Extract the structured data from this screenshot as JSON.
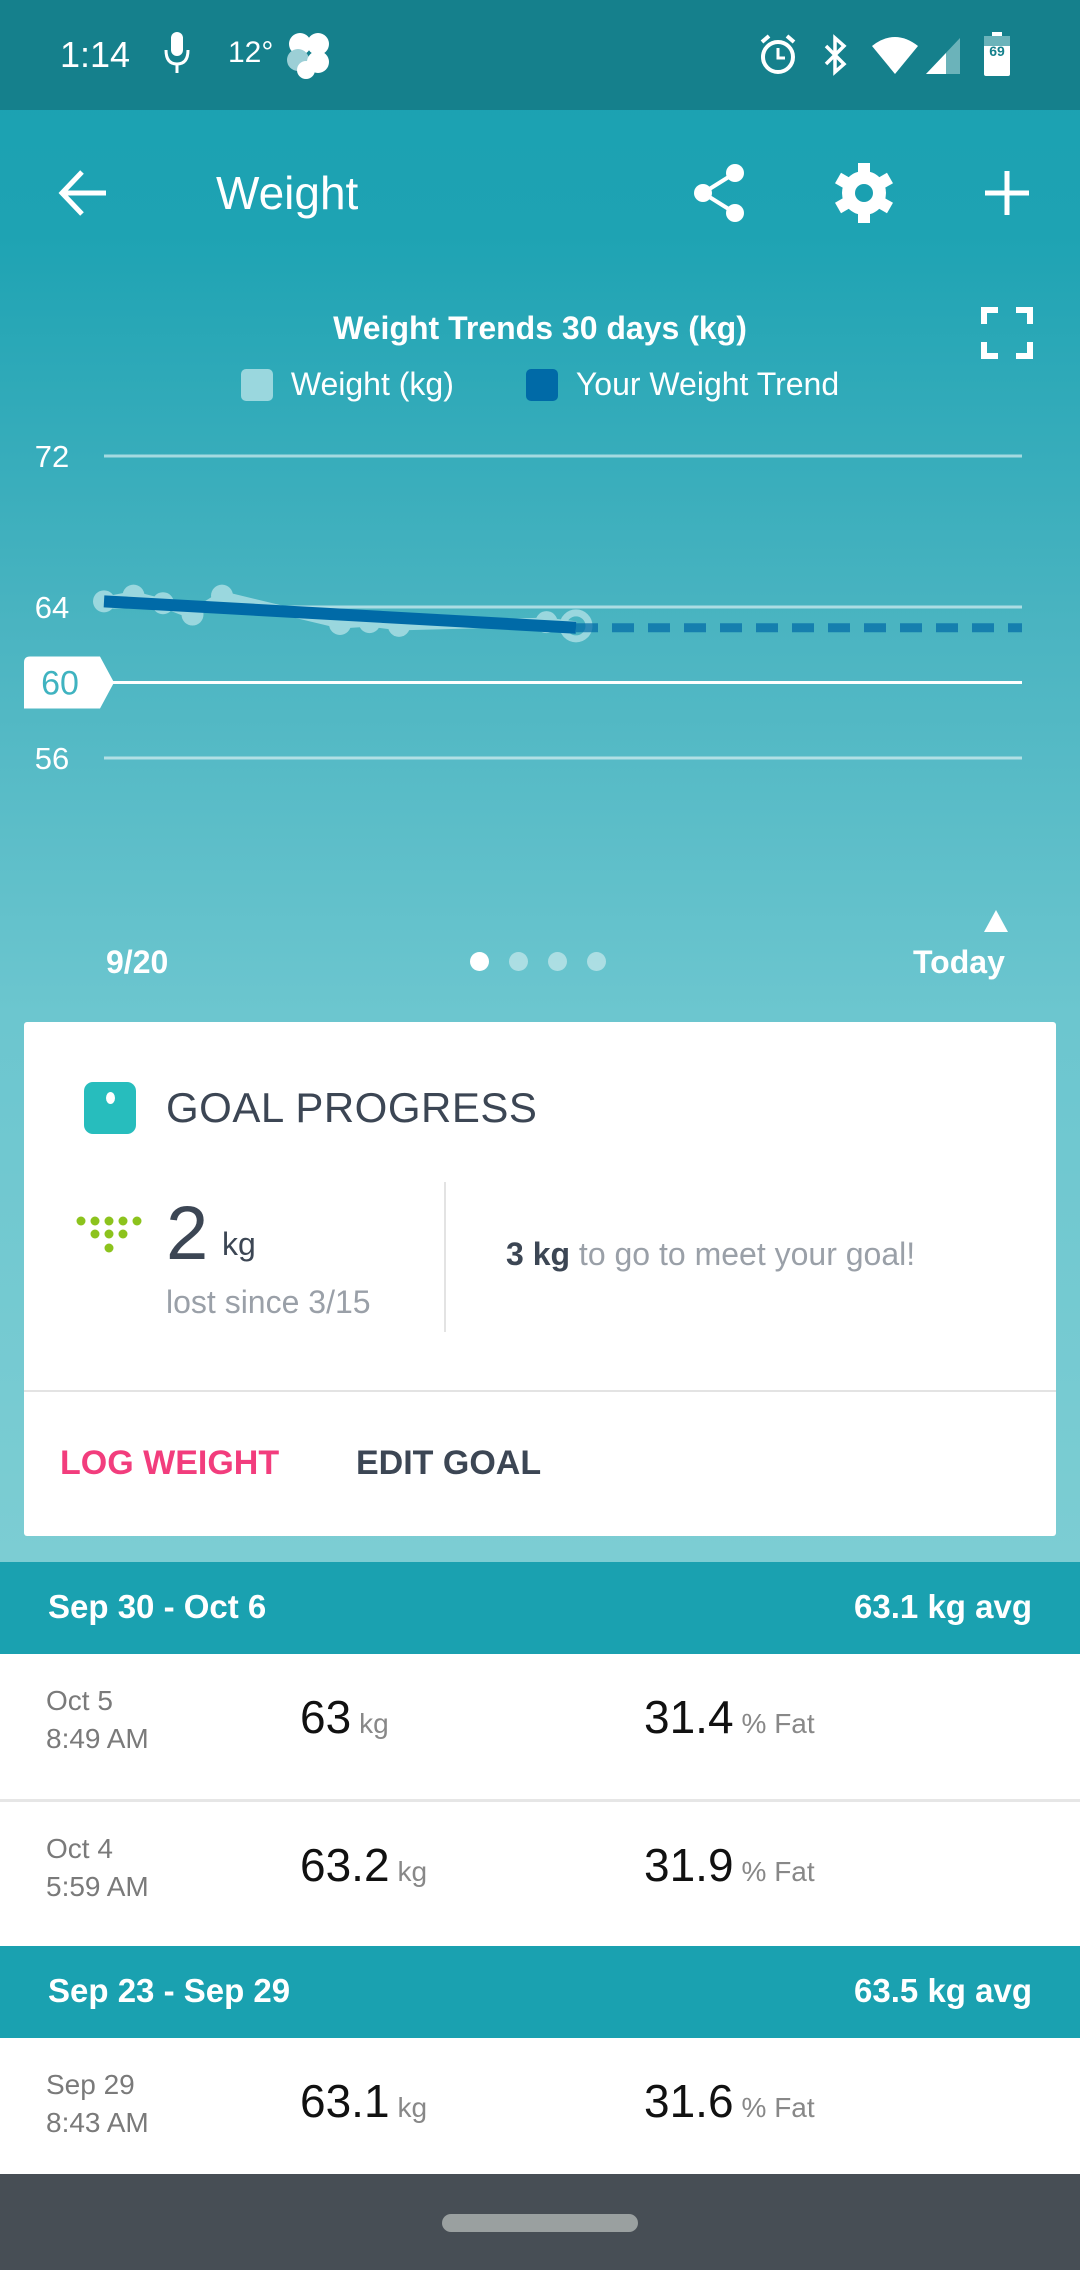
{
  "status_bar": {
    "time": "1:14",
    "temperature": "12°",
    "battery": "69",
    "icons": [
      "mic-icon",
      "fan-icon",
      "alarm-icon",
      "bluetooth-icon",
      "wifi-icon",
      "cell-signal-icon",
      "battery-icon"
    ]
  },
  "app_bar": {
    "title": "Weight",
    "back_icon": "arrow-left-icon",
    "share_icon": "share-icon",
    "settings_icon": "gear-icon",
    "add_icon": "plus-icon"
  },
  "chart": {
    "title": "Weight Trends 30 days (kg)",
    "expand_icon": "fullscreen-icon",
    "legend": [
      {
        "label": "Weight (kg)",
        "color": "#9ad7de"
      },
      {
        "label": "Your Weight Trend",
        "color": "#006aa7"
      }
    ],
    "x_start_label": "9/20",
    "x_end_label": "Today",
    "goal_label": "60",
    "pager": {
      "count": 4,
      "active": 0
    }
  },
  "chart_data": {
    "type": "line",
    "title": "Weight Trends 30 days (kg)",
    "xlabel": "",
    "ylabel": "kg",
    "y_ticks": [
      72,
      64,
      56
    ],
    "ylim": [
      54,
      74
    ],
    "goal_line": 60,
    "x_range_days": [
      0,
      30
    ],
    "x_tick_labels": [
      "9/20",
      "Today"
    ],
    "series": [
      {
        "name": "Weight (kg)",
        "color": "#9ad7de",
        "points": [
          [
            0,
            64.3
          ],
          [
            1,
            64.6
          ],
          [
            2,
            64.2
          ],
          [
            3,
            63.6
          ],
          [
            4,
            64.6
          ],
          [
            8,
            63.1
          ],
          [
            9,
            63.2
          ],
          [
            10,
            63.0
          ],
          [
            15,
            63.2
          ],
          [
            16,
            63.0
          ]
        ]
      },
      {
        "name": "Your Weight Trend",
        "color": "#006aa7",
        "points": [
          [
            0,
            64.3
          ],
          [
            16,
            62.9
          ]
        ],
        "projection": [
          [
            16,
            62.9
          ],
          [
            31,
            62.9
          ]
        ]
      }
    ]
  },
  "goal_progress": {
    "heading": "GOAL PROGRESS",
    "lost_value": "2",
    "lost_unit": "kg",
    "lost_since": "lost since 3/15",
    "to_go_value": "3 kg",
    "to_go_text": "to go to meet your goal!",
    "log_weight_label": "LOG WEIGHT",
    "edit_goal_label": "EDIT GOAL",
    "accent_color": "#f23d7d"
  },
  "weeks": [
    {
      "range": "Sep 30 - Oct 6",
      "avg": "63.1 kg avg",
      "entries": [
        {
          "date": "Oct 5",
          "time": "8:49 AM",
          "weight": "63",
          "weight_unit": "kg",
          "fat": "31.4",
          "fat_unit": "% Fat"
        },
        {
          "date": "Oct 4",
          "time": "5:59 AM",
          "weight": "63.2",
          "weight_unit": "kg",
          "fat": "31.9",
          "fat_unit": "% Fat"
        }
      ]
    },
    {
      "range": "Sep 23 - Sep 29",
      "avg": "63.5 kg avg",
      "entries": [
        {
          "date": "Sep 29",
          "time": "8:43 AM",
          "weight": "63.1",
          "weight_unit": "kg",
          "fat": "31.6",
          "fat_unit": "% Fat"
        }
      ]
    }
  ]
}
